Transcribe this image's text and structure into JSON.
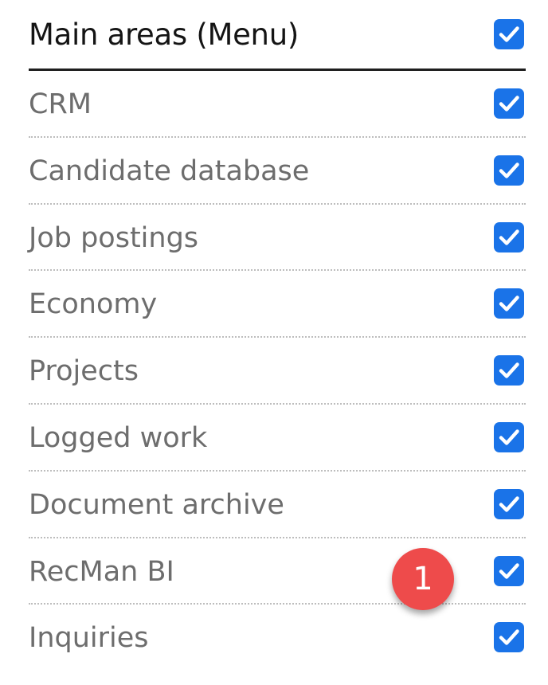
{
  "header": {
    "title": "Main areas (Menu)",
    "checked": true
  },
  "items": [
    {
      "label": "CRM",
      "checked": true
    },
    {
      "label": "Candidate database",
      "checked": true
    },
    {
      "label": "Job postings",
      "checked": true
    },
    {
      "label": "Economy",
      "checked": true
    },
    {
      "label": "Projects",
      "checked": true
    },
    {
      "label": "Logged work",
      "checked": true
    },
    {
      "label": "Document archive",
      "checked": true
    },
    {
      "label": "RecMan BI",
      "checked": true
    },
    {
      "label": "Inquiries",
      "checked": true
    }
  ],
  "annotation": {
    "number": "1"
  },
  "colors": {
    "checkbox": "#1a73e8",
    "badge": "#ee4b4b",
    "label": "#6d6d6d",
    "title": "#141414"
  }
}
